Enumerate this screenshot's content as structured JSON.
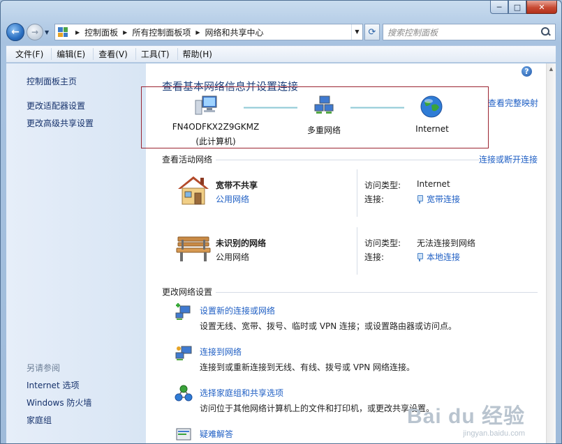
{
  "window": {
    "caption": {
      "minimize": "─",
      "maximize": "□",
      "close": "✕"
    }
  },
  "address": {
    "crumbs": [
      "控制面板",
      "所有控制面板项",
      "网络和共享中心"
    ]
  },
  "search": {
    "placeholder": "搜索控制面板"
  },
  "menu": [
    "文件(F)",
    "编辑(E)",
    "查看(V)",
    "工具(T)",
    "帮助(H)"
  ],
  "sidebar": {
    "top_links": [
      "控制面板主页",
      "更改适配器设置",
      "更改高级共享设置"
    ],
    "see_also": "另请参阅",
    "bottom_links": [
      "Internet 选项",
      "Windows 防火墙",
      "家庭组"
    ]
  },
  "main": {
    "title": "查看基本网络信息并设置连接",
    "map_link": "查看完整映射",
    "map": {
      "computer_name": "FN4ODFKX2Z9GKMZ",
      "computer_sub": "(此计算机)",
      "network": "多重网络",
      "internet": "Internet"
    },
    "active_title": "查看活动网络",
    "active_link": "连接或断开连接",
    "networks": [
      {
        "name": "宽带不共享",
        "type": "公用网络",
        "access_label": "访问类型:",
        "access_value": "Internet",
        "conn_label": "连接:",
        "conn_value": "宽带连接"
      },
      {
        "name": "未识别的网络",
        "type": "公用网络",
        "access_label": "访问类型:",
        "access_value": "无法连接到网络",
        "conn_label": "连接:",
        "conn_value": "本地连接"
      }
    ],
    "change_title": "更改网络设置",
    "tasks": [
      {
        "title": "设置新的连接或网络",
        "desc": "设置无线、宽带、拨号、临时或 VPN 连接；或设置路由器或访问点。"
      },
      {
        "title": "连接到网络",
        "desc": "连接到或重新连接到无线、有线、拨号或 VPN 网络连接。"
      },
      {
        "title": "选择家庭组和共享选项",
        "desc": "访问位于其他网络计算机上的文件和打印机，或更改共享设置。"
      },
      {
        "title": "疑难解答",
        "desc": ""
      }
    ]
  },
  "watermark": {
    "logo": "Bai du 经验",
    "sub": "jingyan.baidu.com"
  },
  "colors": {
    "link": "#1f5fc4",
    "title": "#1c3f7a",
    "highlight_box": "#9b2330"
  }
}
